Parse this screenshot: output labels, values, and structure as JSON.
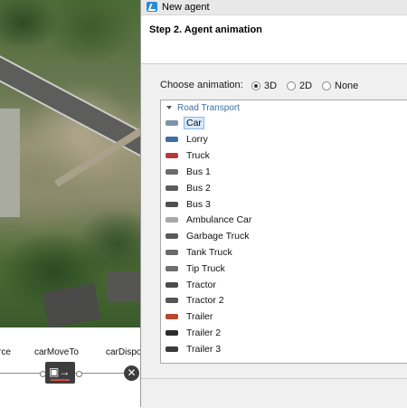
{
  "window": {
    "title": "New agent"
  },
  "header": {
    "step_title": "Step 2. Agent animation"
  },
  "animation": {
    "label": "Choose animation:",
    "options": [
      {
        "label": "3D",
        "selected": true
      },
      {
        "label": "2D",
        "selected": false
      },
      {
        "label": "None",
        "selected": false
      }
    ]
  },
  "list": {
    "category": "Road Transport",
    "items": [
      {
        "label": "Car",
        "selected": true,
        "icon": "car-icon",
        "color": "#7d93aa"
      },
      {
        "label": "Lorry",
        "selected": false,
        "icon": "lorry-icon",
        "color": "#3f6ea0"
      },
      {
        "label": "Truck",
        "selected": false,
        "icon": "truck-icon",
        "color": "#b43a3a"
      },
      {
        "label": "Bus 1",
        "selected": false,
        "icon": "bus-icon",
        "color": "#6b6b6b"
      },
      {
        "label": "Bus 2",
        "selected": false,
        "icon": "bus-icon",
        "color": "#5c5c5c"
      },
      {
        "label": "Bus 3",
        "selected": false,
        "icon": "bus-icon",
        "color": "#4f4f4f"
      },
      {
        "label": "Ambulance Car",
        "selected": false,
        "icon": "ambulance-icon",
        "color": "#a8a8a8"
      },
      {
        "label": "Garbage Truck",
        "selected": false,
        "icon": "garbage-truck-icon",
        "color": "#5a5a5a"
      },
      {
        "label": "Tank Truck",
        "selected": false,
        "icon": "tank-truck-icon",
        "color": "#6a6a6a"
      },
      {
        "label": "Tip Truck",
        "selected": false,
        "icon": "tip-truck-icon",
        "color": "#6f6f6f"
      },
      {
        "label": "Tractor",
        "selected": false,
        "icon": "tractor-icon",
        "color": "#4c4c4c"
      },
      {
        "label": "Tractor 2",
        "selected": false,
        "icon": "tractor-icon",
        "color": "#555555"
      },
      {
        "label": "Trailer",
        "selected": false,
        "icon": "trailer-icon",
        "color": "#b8452f"
      },
      {
        "label": "Trailer 2",
        "selected": false,
        "icon": "trailer-icon",
        "color": "#2b2b2b"
      },
      {
        "label": "Trailer 3",
        "selected": false,
        "icon": "trailer-icon",
        "color": "#3a3a3a"
      }
    ]
  },
  "flowchart": {
    "source_label": "rce",
    "move_label": "carMoveTo",
    "dispose_label": "carDispo"
  }
}
